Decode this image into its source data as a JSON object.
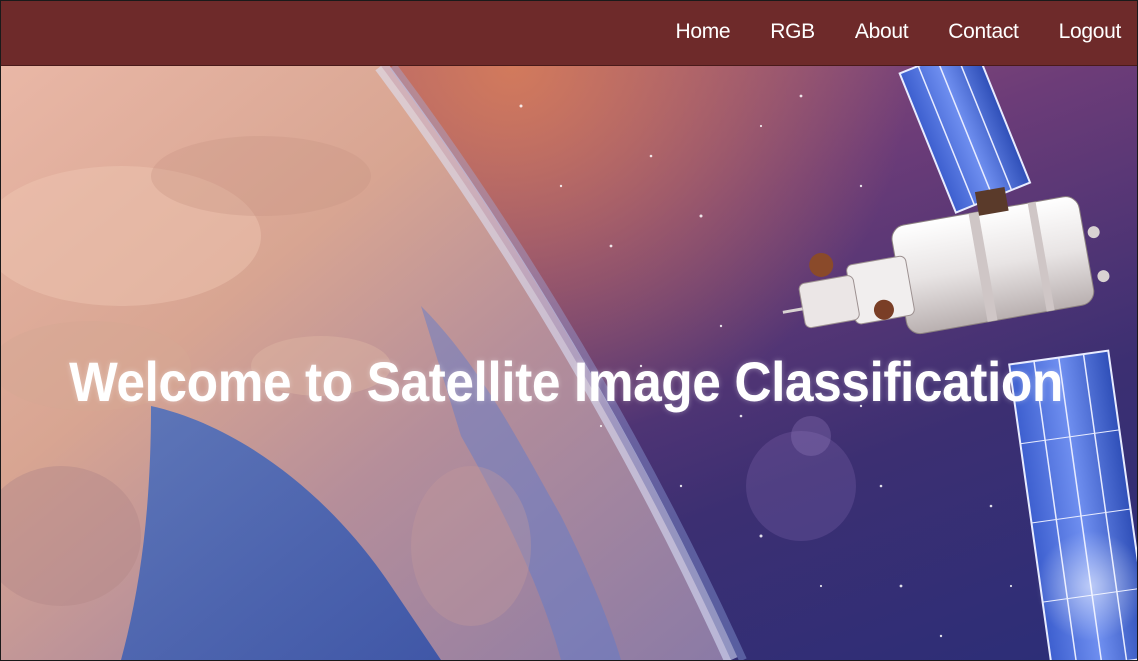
{
  "nav": {
    "items": [
      {
        "label": "Home"
      },
      {
        "label": "RGB"
      },
      {
        "label": "About"
      },
      {
        "label": "Contact"
      },
      {
        "label": "Logout"
      }
    ]
  },
  "hero": {
    "title": "Welcome to Satellite Image Classification",
    "background_image": "earth-from-space-with-satellite"
  },
  "colors": {
    "navbar": "#6e2a2a",
    "nav_text": "#ffffff",
    "title_text": "#ffffff"
  }
}
